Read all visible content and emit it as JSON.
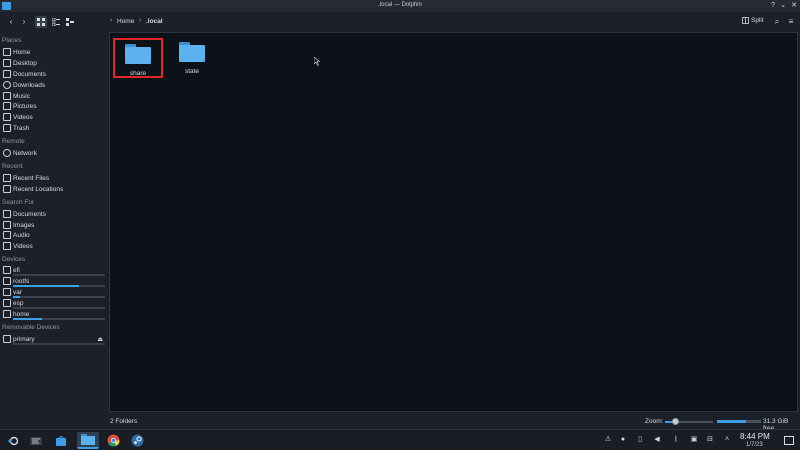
{
  "window": {
    "title": ".local — Dolphin"
  },
  "toolbar": {
    "breadcrumbs": [
      "Home",
      ".local"
    ],
    "split_label": "Split"
  },
  "sidebar": {
    "sections": {
      "places": "Places",
      "remote": "Remote",
      "recent": "Recent",
      "search_for": "Search For",
      "devices": "Devices",
      "removable": "Removable Devices"
    },
    "places": [
      {
        "label": "Home",
        "icon": "home-icon"
      },
      {
        "label": "Desktop",
        "icon": "desktop-icon"
      },
      {
        "label": "Documents",
        "icon": "documents-icon"
      },
      {
        "label": "Downloads",
        "icon": "downloads-icon"
      },
      {
        "label": "Music",
        "icon": "music-icon"
      },
      {
        "label": "Pictures",
        "icon": "pictures-icon"
      },
      {
        "label": "Videos",
        "icon": "videos-icon"
      },
      {
        "label": "Trash",
        "icon": "trash-icon"
      }
    ],
    "remote": [
      {
        "label": "Network",
        "icon": "network-icon"
      }
    ],
    "recent": [
      {
        "label": "Recent Files",
        "icon": "recent-files-icon"
      },
      {
        "label": "Recent Locations",
        "icon": "recent-locations-icon"
      }
    ],
    "search_for": [
      {
        "label": "Documents",
        "icon": "documents-icon"
      },
      {
        "label": "Images",
        "icon": "images-icon"
      },
      {
        "label": "Audio",
        "icon": "audio-icon"
      },
      {
        "label": "Videos",
        "icon": "videos-icon"
      }
    ],
    "devices": [
      {
        "label": "efi",
        "usage": 0.0
      },
      {
        "label": "rootfs",
        "usage": 0.72
      },
      {
        "label": "var",
        "usage": 0.08
      },
      {
        "label": "esp",
        "usage": 0.0
      },
      {
        "label": "home",
        "usage": 0.32
      }
    ],
    "removable": [
      {
        "label": "primary"
      }
    ]
  },
  "main": {
    "items": [
      {
        "label": "share",
        "type": "folder",
        "highlighted": true
      },
      {
        "label": "state",
        "type": "folder",
        "highlighted": false
      }
    ]
  },
  "status": {
    "count": "2 Folders",
    "zoom_label": "Zoom:",
    "zoom_level": 0.2,
    "free_space": "31.3 GiB free",
    "disk_used_fraction": 0.65
  },
  "taskbar": {
    "apps": [
      "steamos-menu-icon",
      "mixer-icon",
      "discover-store-icon",
      "dolphin-icon",
      "chrome-icon",
      "steam-icon"
    ],
    "tray": [
      "alert-icon",
      "steam-tray-icon",
      "clipboard-icon",
      "volume-icon",
      "bluetooth-icon",
      "storage-icon",
      "network-wired-icon",
      "chevron-up-icon"
    ],
    "time": "8:44 PM",
    "date": "1/7/23"
  },
  "colors": {
    "accent": "#3d9ee8",
    "highlight_border": "#e2262b",
    "folder": "#5cb2ee"
  }
}
